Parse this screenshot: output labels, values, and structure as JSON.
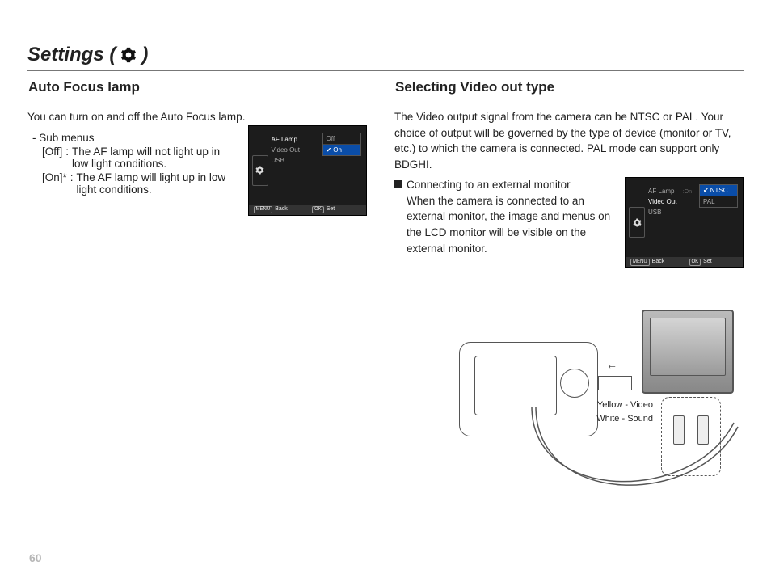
{
  "page_number": "60",
  "title": {
    "prefix": "Settings (",
    "suffix": ")",
    "icon": "gear-icon"
  },
  "left": {
    "heading": "Auto Focus lamp",
    "intro": "You can turn on and off the Auto Focus lamp.",
    "submenu_label": "- Sub menus",
    "items": [
      {
        "key": "[Off]",
        "desc": "The AF lamp will not light up in low light conditions."
      },
      {
        "key": "[On]*",
        "desc": "The AF lamp will light up in low light conditions."
      }
    ],
    "lcd": {
      "menu": [
        {
          "label": "AF Lamp",
          "active": true
        },
        {
          "label": "Video Out",
          "active": false
        },
        {
          "label": "USB",
          "active": false
        }
      ],
      "options": [
        {
          "label": "Off",
          "selected": false,
          "checked": false
        },
        {
          "label": "On",
          "selected": true,
          "checked": true
        }
      ],
      "footer": {
        "left_label": "Back",
        "right_label": "Set",
        "left_badge": "MENU",
        "right_badge": "OK"
      }
    }
  },
  "right": {
    "heading": "Selecting Video out type",
    "intro": "The Video output signal from the camera can be NTSC or PAL. Your choice of output will be governed by the type of device (monitor or TV, etc.) to which the camera is connected. PAL mode can support only BDGHI.",
    "block_title": "Connecting to an external monitor",
    "block_body": "When the camera is connected to an external monitor, the image and menus on the LCD monitor will be visible on the external monitor.",
    "lcd": {
      "menu": [
        {
          "label": "AF Lamp",
          "active": false,
          "value": ":On"
        },
        {
          "label": "Video Out",
          "active": true
        },
        {
          "label": "USB",
          "active": false
        }
      ],
      "options": [
        {
          "label": "NTSC",
          "selected": true,
          "checked": true
        },
        {
          "label": "PAL",
          "selected": false,
          "checked": false
        }
      ],
      "footer": {
        "left_label": "Back",
        "right_label": "Set",
        "left_badge": "MENU",
        "right_badge": "OK"
      }
    },
    "diagram": {
      "yellow": "Yellow - Video",
      "white": "White - Sound"
    }
  }
}
